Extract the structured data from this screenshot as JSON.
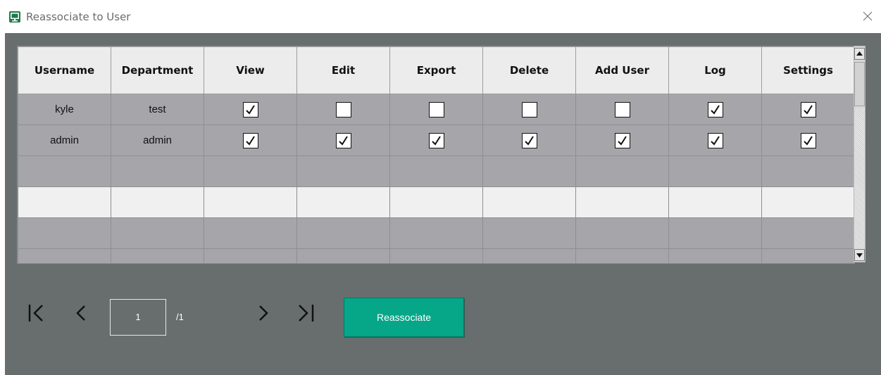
{
  "window": {
    "title": "Reassociate to User",
    "icon": "monitor-app-icon",
    "close_icon": "close-icon"
  },
  "table": {
    "columns": [
      "Username",
      "Department",
      "View",
      "Edit",
      "Export",
      "Delete",
      "Add User",
      "Log",
      "Settings"
    ],
    "rows": [
      {
        "username": "kyle",
        "department": "test",
        "permissions": [
          true,
          false,
          false,
          false,
          false,
          true,
          true
        ]
      },
      {
        "username": "admin",
        "department": "admin",
        "permissions": [
          true,
          true,
          true,
          true,
          true,
          true,
          true
        ]
      }
    ],
    "empty_rows": 4
  },
  "pager": {
    "first_icon": "first-page-icon",
    "prev_icon": "prev-page-icon",
    "next_icon": "next-page-icon",
    "last_icon": "last-page-icon",
    "current_page": "1",
    "total_label": "/1"
  },
  "actions": {
    "reassociate_label": "Reassociate"
  },
  "colors": {
    "background": "#686e6e",
    "row_gray": "#a6a5aa",
    "row_light": "#f0f0f0",
    "accent": "#06a688"
  }
}
